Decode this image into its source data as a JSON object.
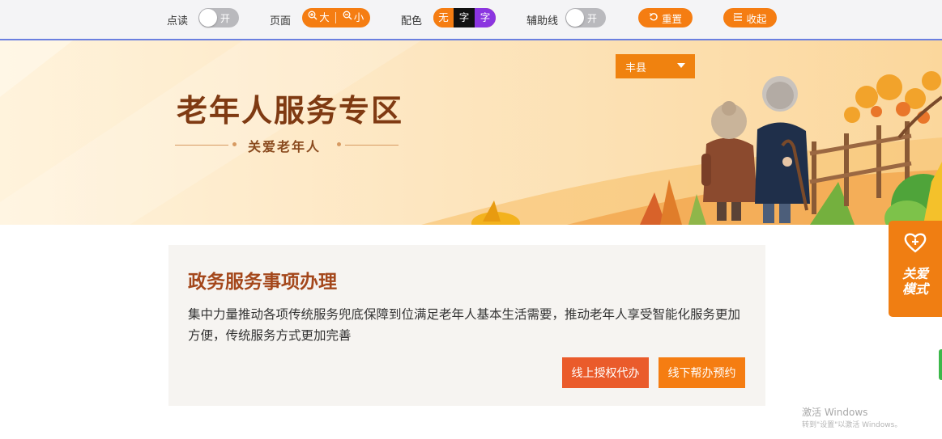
{
  "toolbar": {
    "read_label": "点读",
    "read_toggle": "开",
    "page_label": "页面",
    "zoom_in": "大",
    "zoom_out": "小",
    "color_label": "配色",
    "color_none": "无",
    "color_black": "字",
    "color_purple": "字",
    "guide_label": "辅助线",
    "guide_toggle": "开",
    "reset": "重置",
    "collapse": "收起"
  },
  "banner": {
    "title": "老年人服务专区",
    "subtitle": "关爱老年人",
    "region": "丰县"
  },
  "service": {
    "title": "政务服务事项办理",
    "description": "集中力量推动各项传统服务兜底保障到位满足老年人基本生活需要，推动老年人享受智能化服务更加方便，传统服务方式更加完善",
    "online_button": "线上授权代办",
    "offline_button": "线下帮办预约"
  },
  "side_tab": {
    "label_line1": "关爱",
    "label_line2": "模式"
  },
  "watermark": {
    "line1": "激活 Windows",
    "line2": "转到\"设置\"以激活 Windows。"
  },
  "colors": {
    "accent_orange": "#f57d12",
    "button_red": "#ea5b2b",
    "title_brown": "#7f3a12",
    "purple": "#8b35e0"
  },
  "icons": [
    "zoom-in-icon",
    "zoom-out-icon",
    "reset-icon",
    "collapse-icon",
    "dropdown-caret-icon",
    "heart-plus-icon"
  ]
}
